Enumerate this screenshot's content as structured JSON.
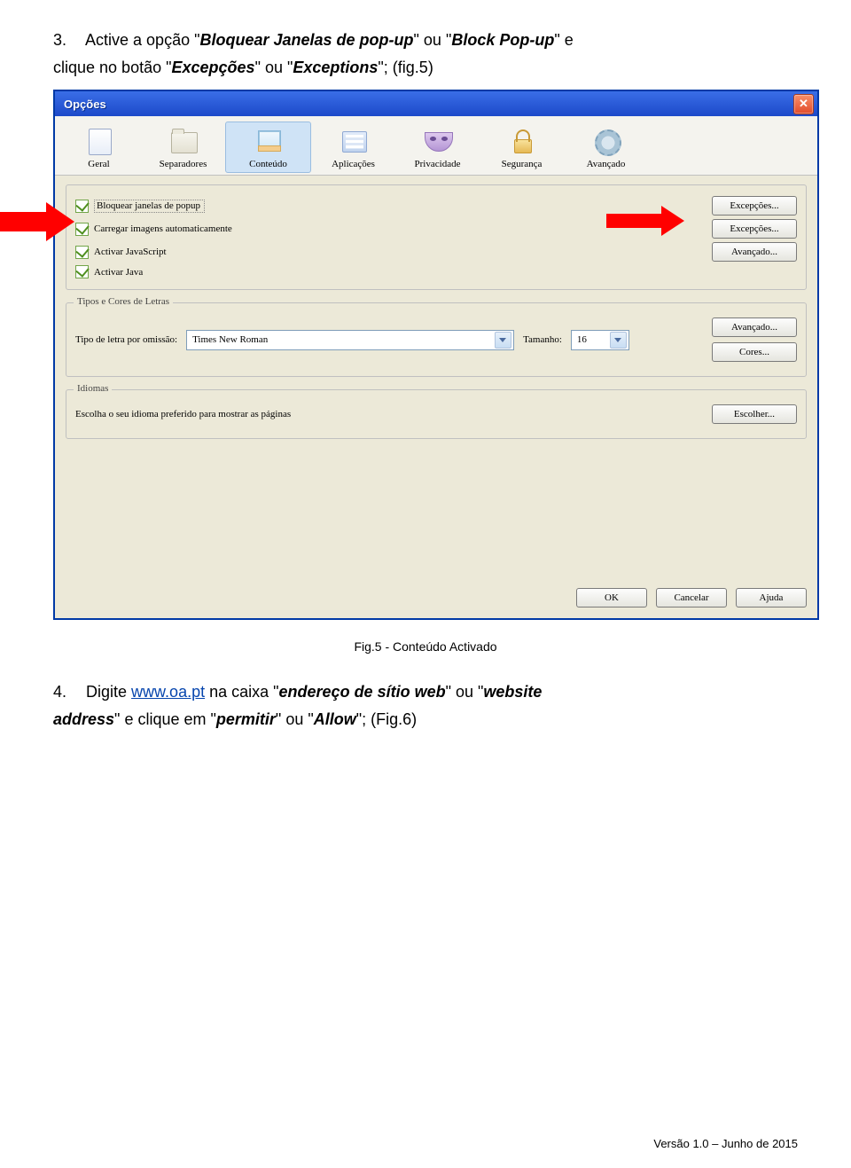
{
  "instruction1": {
    "num": "3.",
    "text1": "Active a opção \"",
    "bold1": "Bloquear Janelas de pop-up",
    "text2": "\" ou \"",
    "bold2": "Block Pop-up",
    "text3": "\" e",
    "line2a": "clique no botão \"",
    "bold3": "Excepções",
    "mid": "\" ou \"",
    "bold4": "Exceptions",
    "line2b": "\"; (fig.5)"
  },
  "dialog": {
    "title": "Opções",
    "toolbar": [
      "Geral",
      "Separadores",
      "Conteúdo",
      "Aplicações",
      "Privacidade",
      "Segurança",
      "Avançado"
    ],
    "checks": [
      "Bloquear janelas de popup",
      "Carregar imagens automaticamente",
      "Activar JavaScript",
      "Activar Java"
    ],
    "rightButtons": [
      "Excepções...",
      "Excepções...",
      "Avançado..."
    ],
    "fontsGroup": {
      "legend": "Tipos e Cores de Letras",
      "label": "Tipo de letra por omissão:",
      "font": "Times New Roman",
      "sizeLabel": "Tamanho:",
      "size": "16",
      "buttons": [
        "Avançado...",
        "Cores..."
      ]
    },
    "langGroup": {
      "legend": "Idiomas",
      "text": "Escolha o seu idioma preferido para mostrar as páginas",
      "button": "Escolher..."
    },
    "footerButtons": [
      "OK",
      "Cancelar",
      "Ajuda"
    ]
  },
  "figcaption": "Fig.5 - Conteúdo Activado",
  "instruction2": {
    "num": "4.",
    "text1": "Digite ",
    "link": "www.oa.pt",
    "text2": " na caixa \"",
    "bold1": "endereço de sítio web",
    "text3": "\" ou \"",
    "bold2": "website",
    "line2a_bold": "address",
    "line2a": "\" e clique em \"",
    "bold3": "permitir",
    "mid": "\" ou \"",
    "bold4": "Allow",
    "line2b": "\"; (Fig.6)"
  },
  "footer": "Versão 1.0 – Junho de 2015"
}
